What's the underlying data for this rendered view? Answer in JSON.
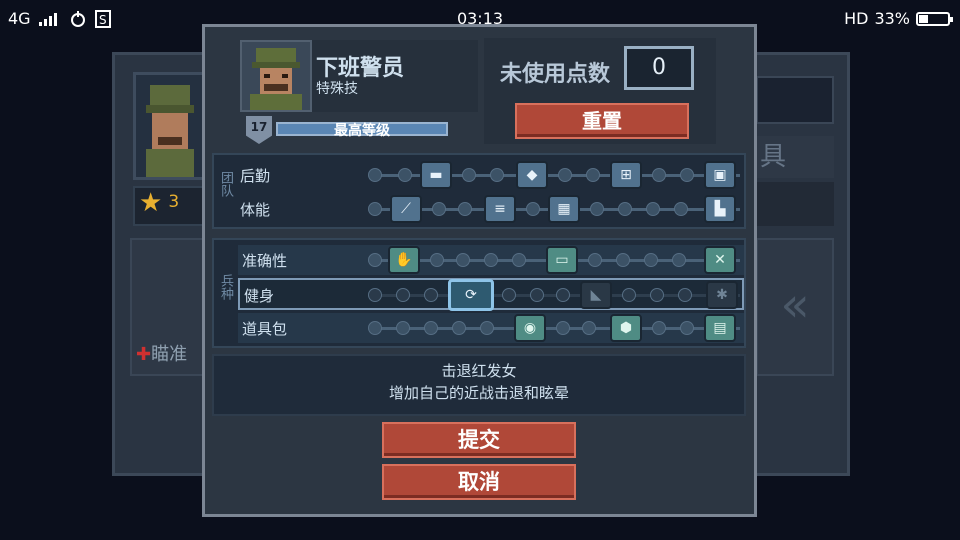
{
  "status_bar": {
    "network": "4G",
    "signal_icon": "signal-bars-icon",
    "time": "03:13",
    "hd": "HD",
    "battery": "33%",
    "battery_level": 0.33
  },
  "background": {
    "stars": "3",
    "aim": "瞄准",
    "right_text": "具"
  },
  "soldier": {
    "name": "下班警员",
    "subtitle": "特殊技",
    "level": "17",
    "level_label": "最高等级",
    "xp_fill": 1.0
  },
  "points": {
    "label": "未使用点数",
    "value": "0"
  },
  "buttons": {
    "reset": "重置",
    "submit": "提交",
    "cancel": "取消"
  },
  "sections": {
    "team_label": "团队",
    "class_label": "兵种"
  },
  "rows": {
    "logistics": "后勤",
    "fitness": "体能",
    "accuracy": "准确性",
    "body": "健身",
    "kit": "道具包"
  },
  "description": {
    "title": "击退红发女",
    "text": "增加自己的近战击退和眩晕"
  },
  "colors": {
    "red_button": "#b04838",
    "panel": "#2c3642",
    "skill_blue": "#51728e",
    "skill_teal": "#4f8c84"
  }
}
